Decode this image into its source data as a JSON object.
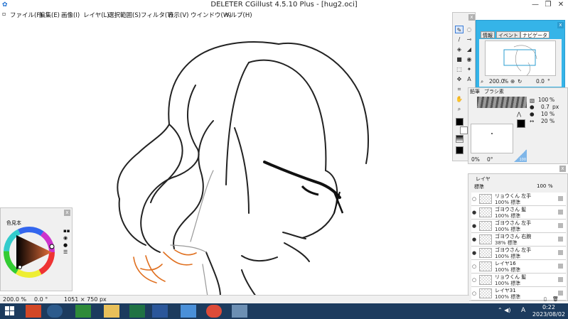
{
  "window": {
    "title": "DELETER CGillust 4.5.10 Plus - [hug2.oci]",
    "controls": [
      "—",
      "❐",
      "✕"
    ]
  },
  "menu": [
    "ファイル(F)",
    "編集(E)",
    "画像(I)",
    "レイヤ(L)",
    "選択範囲(S)",
    "フィルタ(T)",
    "表示(V)",
    "ウインドウ(W)",
    "ヘルプ(H)"
  ],
  "navigator": {
    "tabs": [
      "情報",
      "イベント",
      "ナビゲータ"
    ],
    "zoom": "200.0",
    "zoom_unit": "%",
    "rotation": "0.0",
    "rotation_unit": "°"
  },
  "brush": {
    "tabs": [
      "鉛筆",
      "ブラシ素"
    ],
    "opacity": "100",
    "opacity_unit": "%",
    "size": "0.7",
    "size_unit": "px",
    "density": "10",
    "density_unit": "%",
    "spacing": "20",
    "spacing_unit": "%",
    "lower_percent": "0%",
    "lower_angle": "0°",
    "corner_value": "100"
  },
  "layers": {
    "tab": "レイヤ",
    "blend_mode": "標準",
    "opacity": "100",
    "opacity_unit": "%",
    "items": [
      {
        "name": "リョウくん 左手",
        "info": "100% 標準",
        "visible": false
      },
      {
        "name": "ゴヨウさん 髪",
        "info": "100% 標準",
        "visible": true
      },
      {
        "name": "ゴヨウさん 左手",
        "info": "100% 標準",
        "visible": true
      },
      {
        "name": "ゴヨウさん 右腕",
        "info": "38% 標準",
        "visible": true
      },
      {
        "name": "ゴヨウさん 左手",
        "info": "100% 標準",
        "visible": true
      },
      {
        "name": "レイヤ16",
        "info": "100% 標準",
        "visible": false
      },
      {
        "name": "リョウくん 髪",
        "info": "100% 標準",
        "visible": false
      },
      {
        "name": "レイヤ31",
        "info": "100% 標準",
        "visible": false
      }
    ]
  },
  "color_panel": {
    "tab": "色見本"
  },
  "status": {
    "zoom": "200.0 %",
    "angle": "0.0 °",
    "canvas_size": "1051 × 750 px"
  },
  "taskbar": {
    "apps": [
      "start-icon",
      "powerpoint-icon",
      "media-icon",
      "store-icon",
      "explorer-icon",
      "excel-icon",
      "word-icon",
      "capture-icon",
      "chrome-icon",
      "cgillust-icon"
    ],
    "time": "0:22",
    "date": "2023/08/02",
    "ime": "A"
  },
  "colors": {
    "accent": "#35b4e8",
    "stroke_accent": "#e07020",
    "taskbar": "#1c3b5e"
  }
}
